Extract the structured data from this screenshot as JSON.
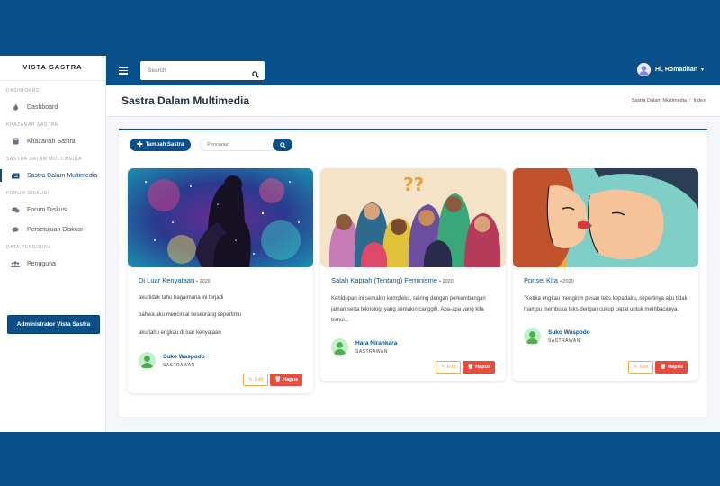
{
  "sidebar": {
    "brand": "VISTA SASTRA",
    "sections": [
      {
        "title": "DASHBOARD",
        "items": [
          {
            "label": "Dashboard",
            "icon": "fire-icon",
            "active": false
          }
        ]
      },
      {
        "title": "KHAZANAH SASTRA",
        "items": [
          {
            "label": "Khazanah Sastra",
            "icon": "book-icon",
            "active": false
          }
        ]
      },
      {
        "title": "SASTRA DALAM MULTIMEDIA",
        "items": [
          {
            "label": "Sastra Dalam Multimedia",
            "icon": "newspaper-icon",
            "active": true
          }
        ]
      },
      {
        "title": "FORUM DISKUSI",
        "items": [
          {
            "label": "Forum Diskusi",
            "icon": "comments-icon",
            "active": false
          },
          {
            "label": "Persetujuan Diskusi",
            "icon": "comment-icon",
            "active": false
          }
        ]
      },
      {
        "title": "DATA PENGGUNA",
        "items": [
          {
            "label": "Pengguna",
            "icon": "users-icon",
            "active": false
          }
        ]
      }
    ],
    "admin_button": "Administrator Vista Sastra"
  },
  "topbar": {
    "search_placeholder": "Search",
    "user_greeting": "Hi, Romadhan"
  },
  "page": {
    "title": "Sastra Dalam Multimedia",
    "breadcrumb": [
      "Sastra Dalam Multimedia",
      "Index"
    ]
  },
  "toolbar": {
    "add_label": "Tambah Sastra",
    "search_placeholder": "Pencarian"
  },
  "cards": [
    {
      "title": "Di Luar Kenyataan",
      "year": "• 2020",
      "lines": [
        "aku tidak tahu bagaimana ini terjadi",
        "bahwa aku mencintai seseorang sepertimu",
        "aku tahu engkau di luar kenyataan"
      ],
      "author": "Suko Waspodo",
      "role": "SASTRAWAN",
      "edit": "Edit",
      "delete": "Hapus"
    },
    {
      "title": "Salah Kaprah (Tentang) Feminisme",
      "year": "• 2020",
      "lines": [
        "Kehidupan ini semakin kompleks, seiring dengan perkembangan jaman serta teknologi yang semakin canggih. Apa-apa yang kita temui..."
      ],
      "author": "Hara Nirankara",
      "role": "SASTRAWAN",
      "edit": "Edit",
      "delete": "Hapus"
    },
    {
      "title": "Ponsel Kita",
      "year": "• 2020",
      "lines": [
        "\"Ketika engkau mengirim pesan teks kepadaku, sepertinya aku tidak mampu membuka teks dengan cukup cepat untuk membacanya."
      ],
      "author": "Suko Waspodo",
      "role": "SASTRAWAN",
      "edit": "Edit",
      "delete": "Hapus"
    }
  ],
  "colors": {
    "primary": "#0b4f8a",
    "outer": "#07508a",
    "danger": "#e74c3c",
    "warning": "#f0ad4e"
  }
}
